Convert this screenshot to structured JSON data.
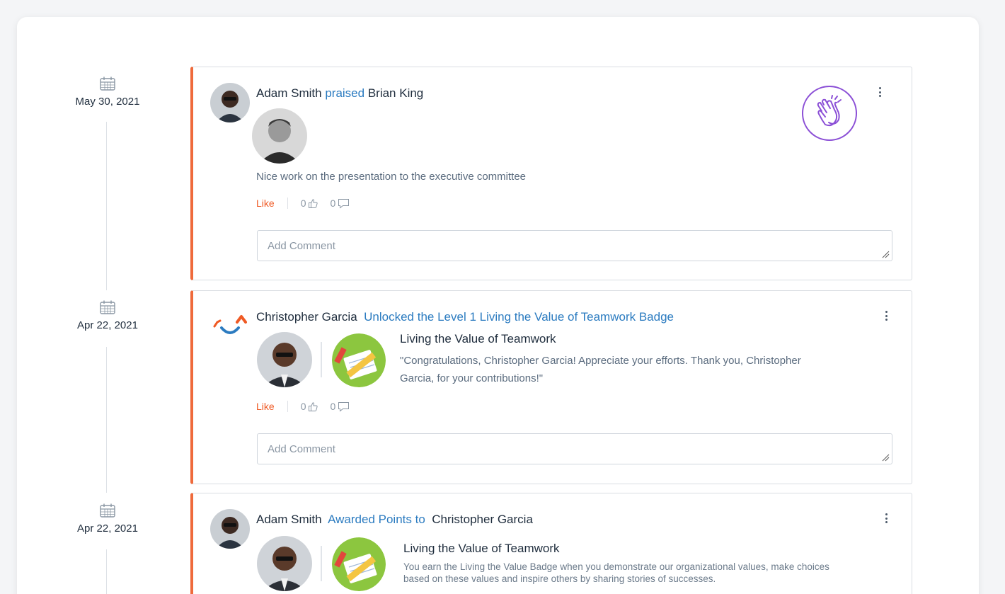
{
  "feed": [
    {
      "date": "May 30, 2021",
      "actor": "Adam Smith",
      "action": "praised",
      "target": "Brian King",
      "message": "Nice work on the presentation to the executive committee",
      "like_label": "Like",
      "likes": "0",
      "comments": "0",
      "comment_placeholder": "Add Comment",
      "badge_icon": "clapping-hands-icon"
    },
    {
      "date": "Apr 22, 2021",
      "actor": "Christopher Garcia",
      "action": "Unlocked the Level 1 Living the Value of Teamwork Badge",
      "badge_title": "Living the Value of Teamwork",
      "badge_text": "\"Congratulations, Christopher Garcia! Appreciate your efforts. Thank you, Christopher Garcia, for your contributions!\"",
      "like_label": "Like",
      "likes": "0",
      "comments": "0",
      "comment_placeholder": "Add Comment"
    },
    {
      "date": "Apr 22, 2021",
      "actor": "Adam Smith",
      "action": "Awarded Points to",
      "target": "Christopher Garcia",
      "badge_title": "Living the Value of Teamwork",
      "badge_text": "You earn the Living the Value Badge when you demonstrate our organizational values, make choices based on these values and inspire others by sharing stories of successes."
    }
  ],
  "colors": {
    "accent_border": "#ef6a3b",
    "like": "#ef5a24",
    "action_link": "#2b7bc0",
    "praise_purple": "#8b4fd6"
  }
}
